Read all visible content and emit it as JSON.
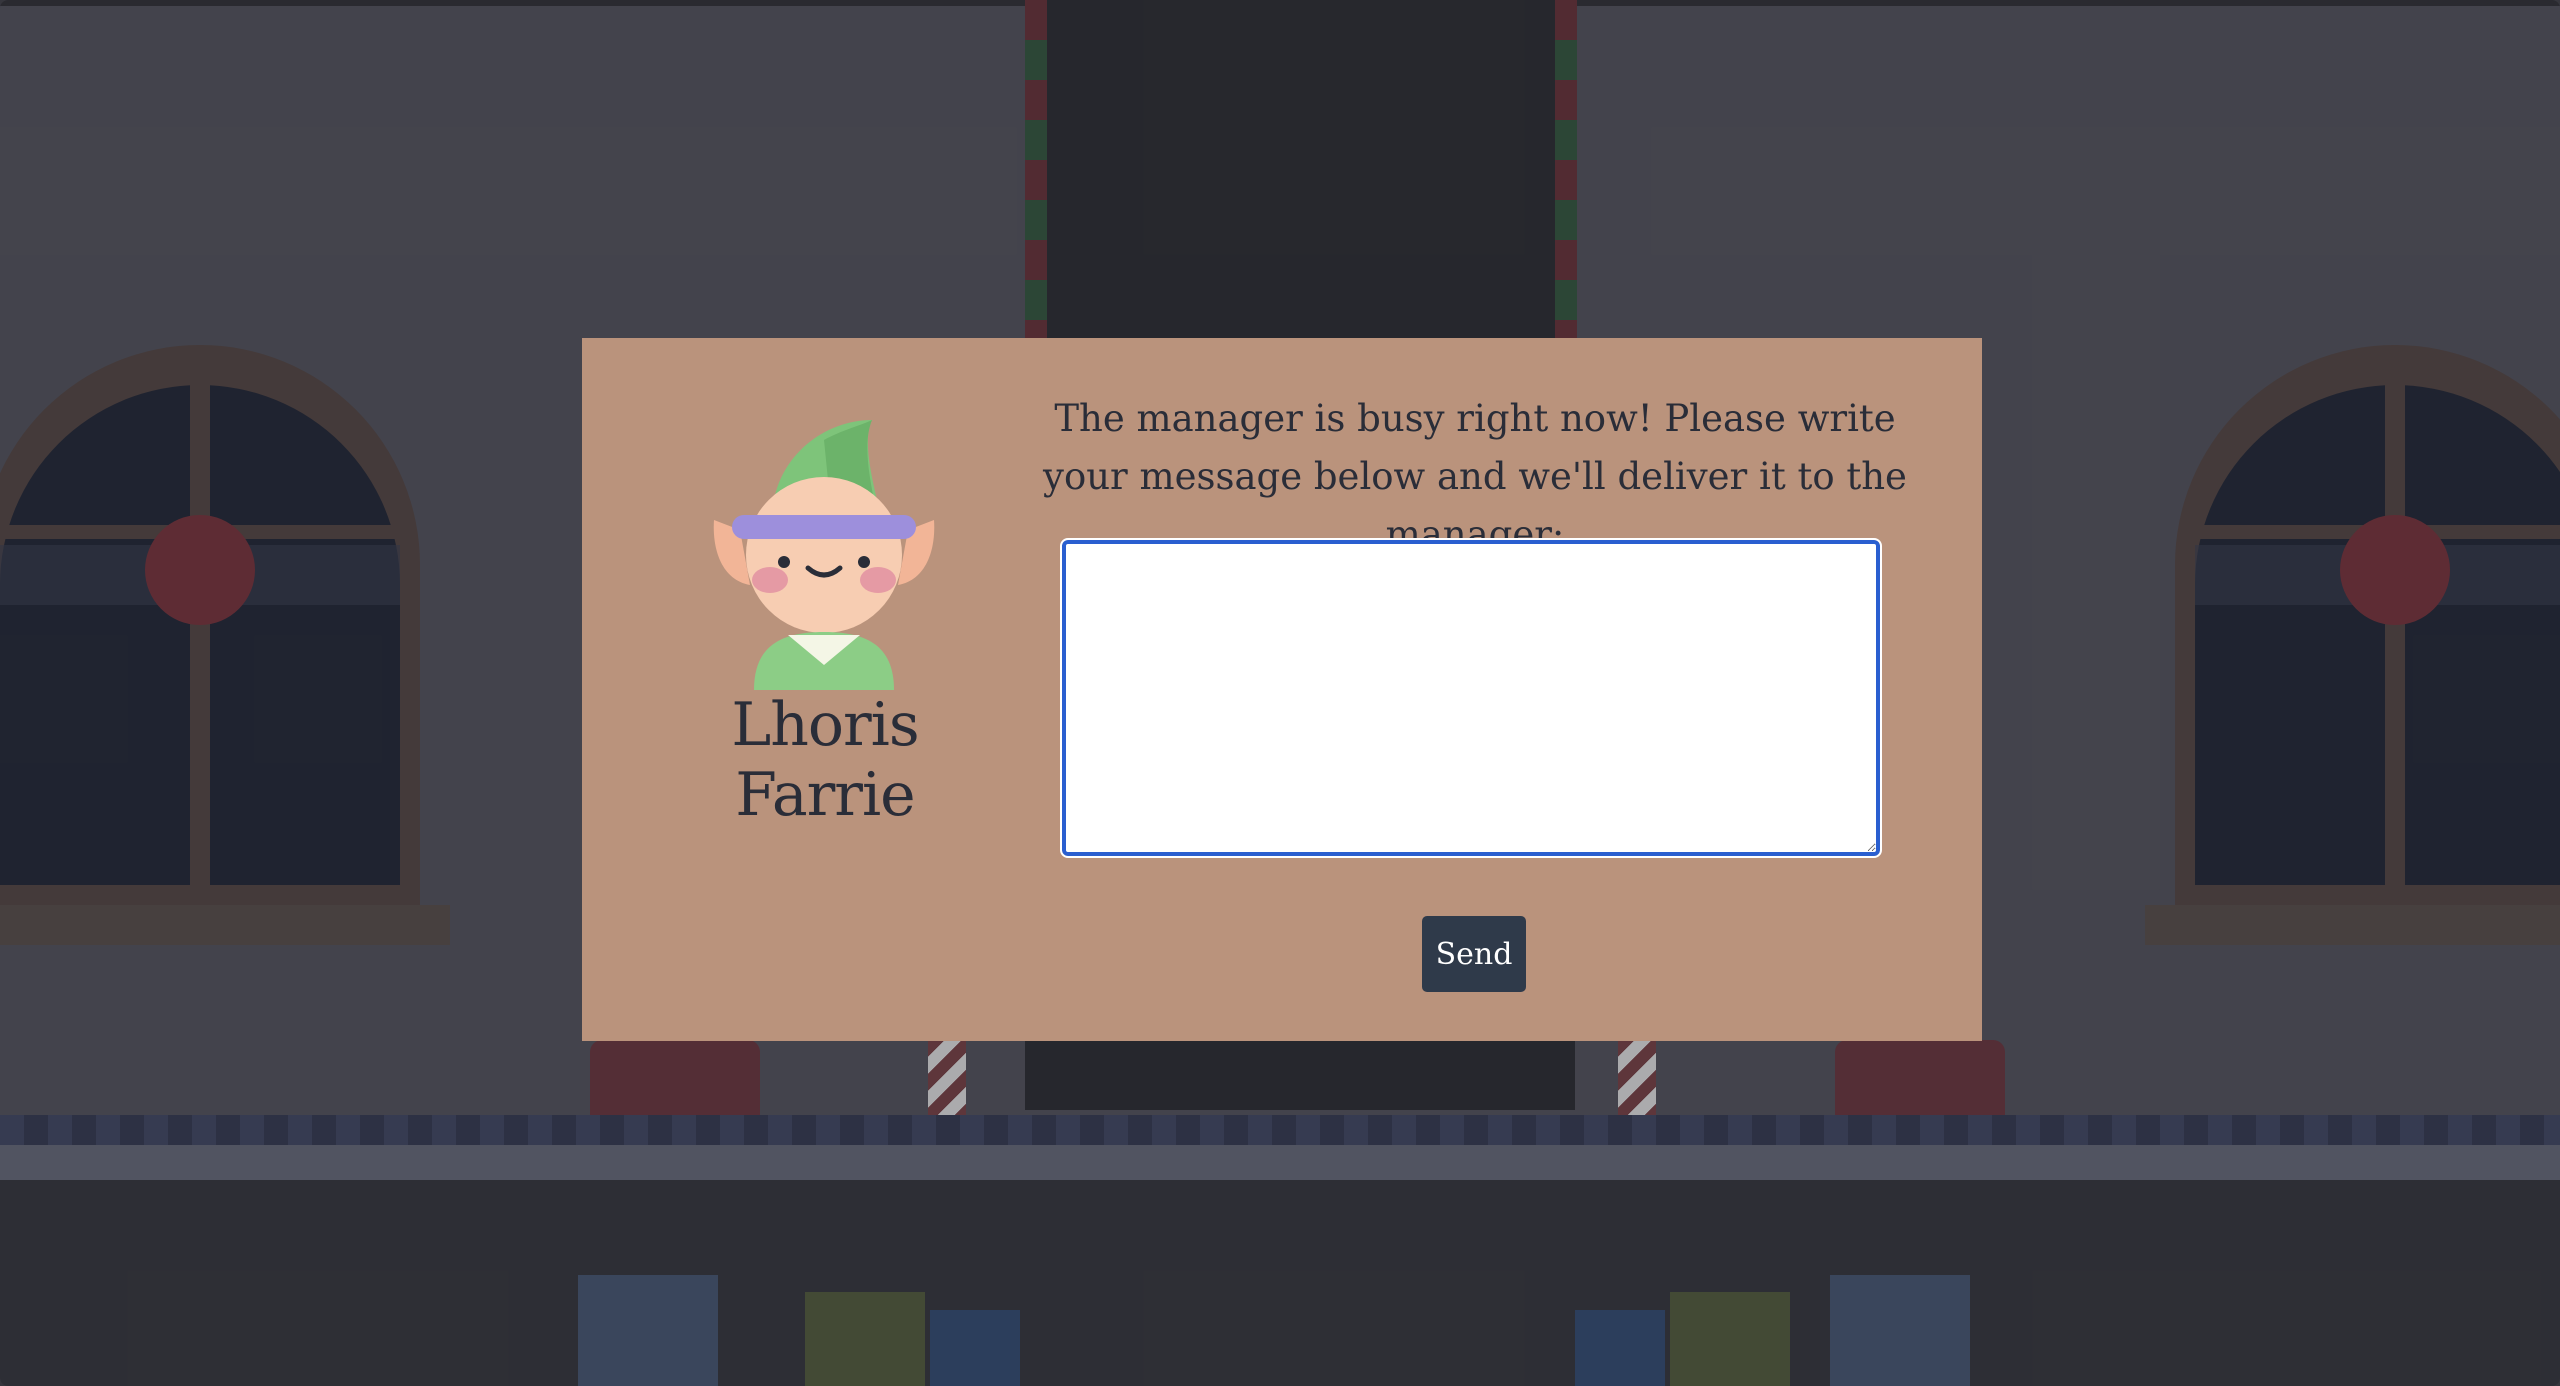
{
  "elf": {
    "name": "Lhoris Farrie",
    "avatar_icon": "elf-avatar-icon"
  },
  "dialog": {
    "message": "The manager is busy right now! Please write your message below and we'll deliver it to the manager:",
    "textarea_value": "",
    "send_label": "Send"
  },
  "colors": {
    "modal_background": "#ba937c",
    "button_background": "#2f3a4a",
    "text": "#2a2d38",
    "textarea_border": "#2a5fd0"
  }
}
